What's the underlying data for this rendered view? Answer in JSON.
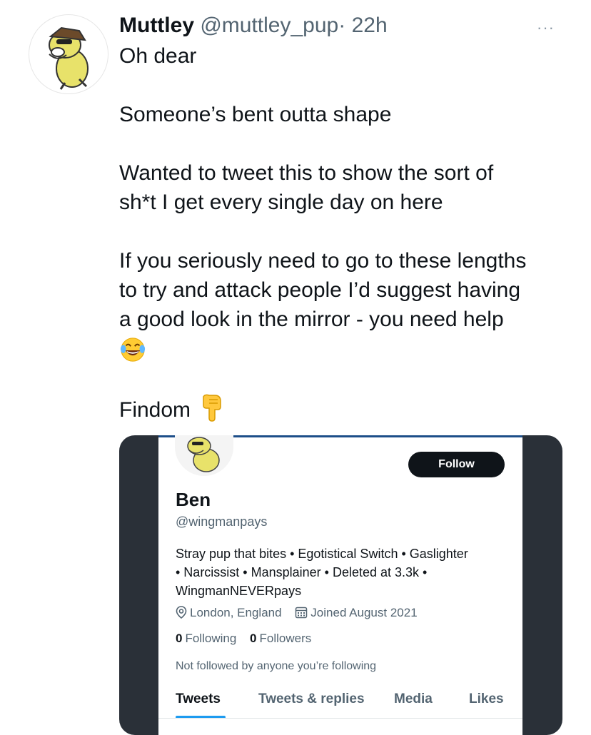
{
  "tweet": {
    "author_name": "Muttley",
    "author_handle": "@muttley_pup",
    "separator": "·",
    "time": "22h",
    "more_label": "···",
    "lines": {
      "l1": "Oh dear",
      "l2": "Someone’s bent outta shape",
      "l3a": "Wanted to tweet this to show the sort of",
      "l3b": "sh*t I get every single day on here",
      "l4a": "If you seriously need to go to these lengths",
      "l4b": "to try and attack people I’d suggest having",
      "l4c": "a good look in the mirror - you need help",
      "l5": "Findom"
    },
    "emoji": {
      "laugh": "laughing-crying-emoji",
      "point": "pointing-down-emoji"
    }
  },
  "embedded_profile": {
    "follow_label": "Follow",
    "name": "Ben",
    "handle": "@wingmanpays",
    "bio_1": "Stray pup that bites • Egotistical Switch • Gaslighter",
    "bio_2": "• Narcissist • Mansplainer • Deleted at 3.3k •",
    "bio_3": "WingmanNEVERpays",
    "location": "London, England",
    "joined": "Joined August 2021",
    "following_count": "0",
    "following_label": "Following",
    "followers_count": "0",
    "followers_label": "Followers",
    "not_followed": "Not followed by anyone you’re following",
    "tabs": [
      "Tweets",
      "Tweets & replies",
      "Media",
      "Likes"
    ]
  },
  "colors": {
    "text": "#0f1419",
    "secondary": "#536471",
    "accent": "#1d9bf0",
    "media_bg": "#2a3038",
    "avatar_dog": "#e8e26a"
  }
}
